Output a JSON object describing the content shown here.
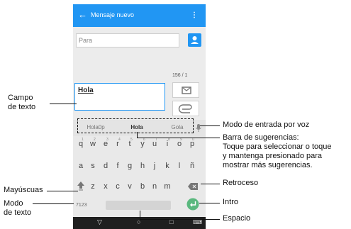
{
  "app": {
    "title": "Mensaje nuevo",
    "back_icon": "arrow-left-icon",
    "menu_icon": "overflow-menu-icon",
    "accent_color": "#2196f3"
  },
  "recipient": {
    "placeholder": "Para",
    "contact_icon": "contact-icon"
  },
  "counter": "156 / 1",
  "message": {
    "value": "Hola"
  },
  "suggestions": [
    "Hola0p",
    "Hola",
    "Gola"
  ],
  "keyboard": {
    "row1": [
      "q",
      "w",
      "e",
      "r",
      "t",
      "y",
      "u",
      "i",
      "o",
      "p"
    ],
    "row1_numbers": [
      "1",
      "2",
      "3",
      "4",
      "5",
      "6",
      "7",
      "8",
      "9",
      "0"
    ],
    "row2": [
      "a",
      "s",
      "d",
      "f",
      "g",
      "h",
      "j",
      "k",
      "l",
      "ñ"
    ],
    "row3": [
      "z",
      "x",
      "c",
      "v",
      "b",
      "n",
      "m"
    ],
    "mode_key": "7123"
  },
  "callouts": {
    "campo_texto": "Campo\nde texto",
    "voz": "Modo de entrada por voz",
    "sugerencias": "Barra de sugerencias:\nToque para seleccionar o toque\ny mantenga presionado para\nmostrar más sugerencias.",
    "mayusculas": "Mayúscuas",
    "retroceso": "Retroceso",
    "modo_texto": "Modo\nde texto",
    "intro": "Intro",
    "espacio": "Espacio"
  }
}
